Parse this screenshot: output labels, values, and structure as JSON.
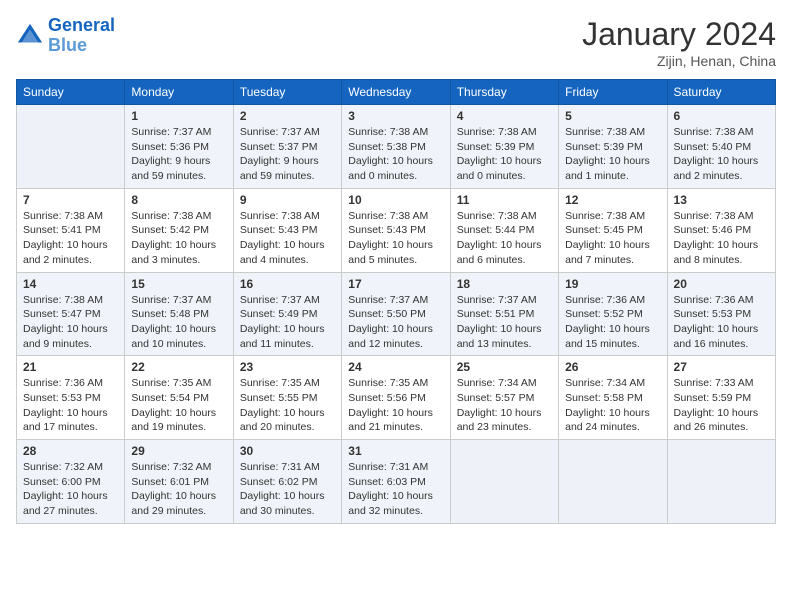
{
  "logo": {
    "line1": "General",
    "line2": "Blue"
  },
  "title": "January 2024",
  "location": "Zijin, Henan, China",
  "weekdays": [
    "Sunday",
    "Monday",
    "Tuesday",
    "Wednesday",
    "Thursday",
    "Friday",
    "Saturday"
  ],
  "weeks": [
    [
      {
        "day": "",
        "info": ""
      },
      {
        "day": "1",
        "info": "Sunrise: 7:37 AM\nSunset: 5:36 PM\nDaylight: 9 hours\nand 59 minutes."
      },
      {
        "day": "2",
        "info": "Sunrise: 7:37 AM\nSunset: 5:37 PM\nDaylight: 9 hours\nand 59 minutes."
      },
      {
        "day": "3",
        "info": "Sunrise: 7:38 AM\nSunset: 5:38 PM\nDaylight: 10 hours\nand 0 minutes."
      },
      {
        "day": "4",
        "info": "Sunrise: 7:38 AM\nSunset: 5:39 PM\nDaylight: 10 hours\nand 0 minutes."
      },
      {
        "day": "5",
        "info": "Sunrise: 7:38 AM\nSunset: 5:39 PM\nDaylight: 10 hours\nand 1 minute."
      },
      {
        "day": "6",
        "info": "Sunrise: 7:38 AM\nSunset: 5:40 PM\nDaylight: 10 hours\nand 2 minutes."
      }
    ],
    [
      {
        "day": "7",
        "info": "Sunrise: 7:38 AM\nSunset: 5:41 PM\nDaylight: 10 hours\nand 2 minutes."
      },
      {
        "day": "8",
        "info": "Sunrise: 7:38 AM\nSunset: 5:42 PM\nDaylight: 10 hours\nand 3 minutes."
      },
      {
        "day": "9",
        "info": "Sunrise: 7:38 AM\nSunset: 5:43 PM\nDaylight: 10 hours\nand 4 minutes."
      },
      {
        "day": "10",
        "info": "Sunrise: 7:38 AM\nSunset: 5:43 PM\nDaylight: 10 hours\nand 5 minutes."
      },
      {
        "day": "11",
        "info": "Sunrise: 7:38 AM\nSunset: 5:44 PM\nDaylight: 10 hours\nand 6 minutes."
      },
      {
        "day": "12",
        "info": "Sunrise: 7:38 AM\nSunset: 5:45 PM\nDaylight: 10 hours\nand 7 minutes."
      },
      {
        "day": "13",
        "info": "Sunrise: 7:38 AM\nSunset: 5:46 PM\nDaylight: 10 hours\nand 8 minutes."
      }
    ],
    [
      {
        "day": "14",
        "info": "Sunrise: 7:38 AM\nSunset: 5:47 PM\nDaylight: 10 hours\nand 9 minutes."
      },
      {
        "day": "15",
        "info": "Sunrise: 7:37 AM\nSunset: 5:48 PM\nDaylight: 10 hours\nand 10 minutes."
      },
      {
        "day": "16",
        "info": "Sunrise: 7:37 AM\nSunset: 5:49 PM\nDaylight: 10 hours\nand 11 minutes."
      },
      {
        "day": "17",
        "info": "Sunrise: 7:37 AM\nSunset: 5:50 PM\nDaylight: 10 hours\nand 12 minutes."
      },
      {
        "day": "18",
        "info": "Sunrise: 7:37 AM\nSunset: 5:51 PM\nDaylight: 10 hours\nand 13 minutes."
      },
      {
        "day": "19",
        "info": "Sunrise: 7:36 AM\nSunset: 5:52 PM\nDaylight: 10 hours\nand 15 minutes."
      },
      {
        "day": "20",
        "info": "Sunrise: 7:36 AM\nSunset: 5:53 PM\nDaylight: 10 hours\nand 16 minutes."
      }
    ],
    [
      {
        "day": "21",
        "info": "Sunrise: 7:36 AM\nSunset: 5:53 PM\nDaylight: 10 hours\nand 17 minutes."
      },
      {
        "day": "22",
        "info": "Sunrise: 7:35 AM\nSunset: 5:54 PM\nDaylight: 10 hours\nand 19 minutes."
      },
      {
        "day": "23",
        "info": "Sunrise: 7:35 AM\nSunset: 5:55 PM\nDaylight: 10 hours\nand 20 minutes."
      },
      {
        "day": "24",
        "info": "Sunrise: 7:35 AM\nSunset: 5:56 PM\nDaylight: 10 hours\nand 21 minutes."
      },
      {
        "day": "25",
        "info": "Sunrise: 7:34 AM\nSunset: 5:57 PM\nDaylight: 10 hours\nand 23 minutes."
      },
      {
        "day": "26",
        "info": "Sunrise: 7:34 AM\nSunset: 5:58 PM\nDaylight: 10 hours\nand 24 minutes."
      },
      {
        "day": "27",
        "info": "Sunrise: 7:33 AM\nSunset: 5:59 PM\nDaylight: 10 hours\nand 26 minutes."
      }
    ],
    [
      {
        "day": "28",
        "info": "Sunrise: 7:32 AM\nSunset: 6:00 PM\nDaylight: 10 hours\nand 27 minutes."
      },
      {
        "day": "29",
        "info": "Sunrise: 7:32 AM\nSunset: 6:01 PM\nDaylight: 10 hours\nand 29 minutes."
      },
      {
        "day": "30",
        "info": "Sunrise: 7:31 AM\nSunset: 6:02 PM\nDaylight: 10 hours\nand 30 minutes."
      },
      {
        "day": "31",
        "info": "Sunrise: 7:31 AM\nSunset: 6:03 PM\nDaylight: 10 hours\nand 32 minutes."
      },
      {
        "day": "",
        "info": ""
      },
      {
        "day": "",
        "info": ""
      },
      {
        "day": "",
        "info": ""
      }
    ]
  ]
}
